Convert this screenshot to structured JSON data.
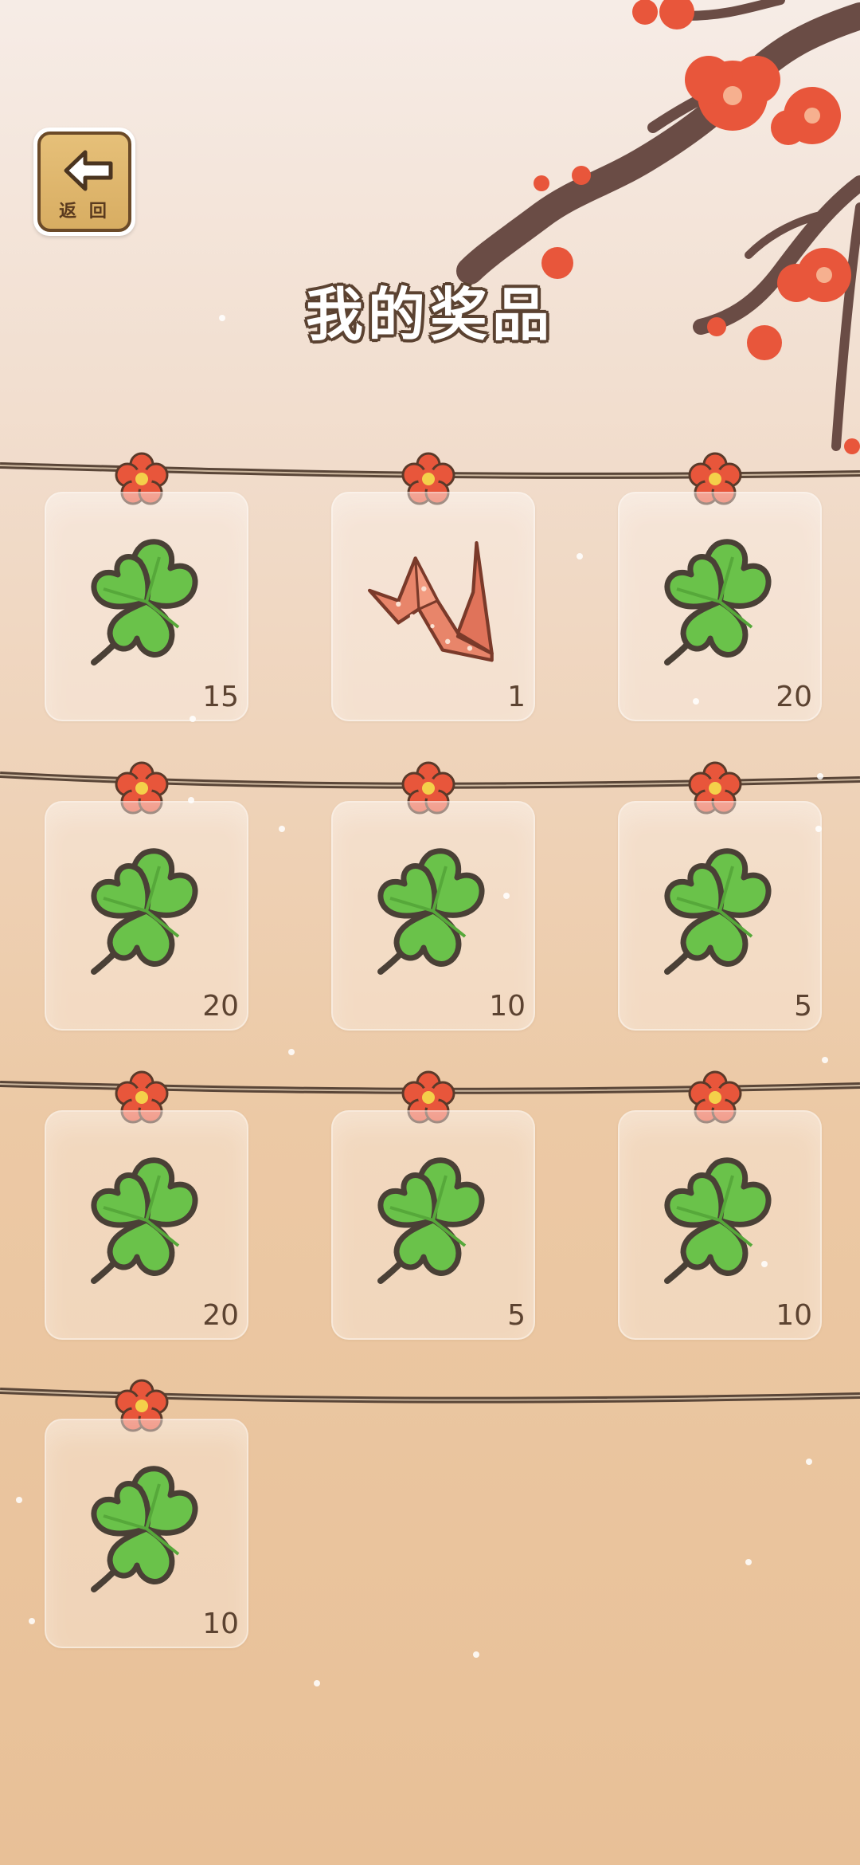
{
  "header": {
    "back_label": "返 回",
    "title": "我的奖品"
  },
  "prizes": [
    {
      "icon": "clover-icon",
      "count": "15"
    },
    {
      "icon": "paper-crane-icon",
      "count": "1"
    },
    {
      "icon": "clover-icon",
      "count": "20"
    },
    {
      "icon": "clover-icon",
      "count": "20"
    },
    {
      "icon": "clover-icon",
      "count": "10"
    },
    {
      "icon": "clover-icon",
      "count": "5"
    },
    {
      "icon": "clover-icon",
      "count": "20"
    },
    {
      "icon": "clover-icon",
      "count": "5"
    },
    {
      "icon": "clover-icon",
      "count": "10"
    },
    {
      "icon": "clover-icon",
      "count": "10"
    }
  ],
  "colors": {
    "background_top": "#f6ece6",
    "background_bottom": "#e8c097",
    "rope": "#5a4638",
    "blossom": "#e8563b",
    "clover": "#6ac24a",
    "outline": "#4a4036"
  }
}
